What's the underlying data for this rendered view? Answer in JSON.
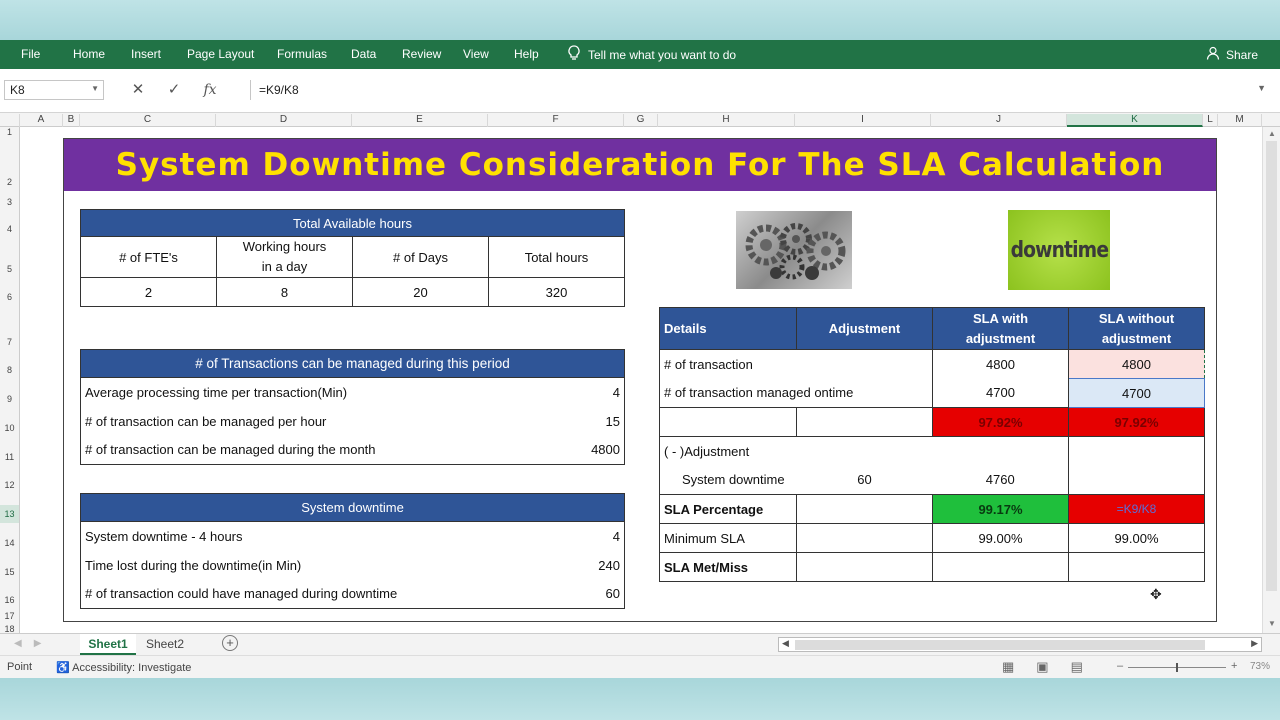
{
  "ribbon": {
    "tabs": [
      "File",
      "Home",
      "Insert",
      "Page Layout",
      "Formulas",
      "Data",
      "Review",
      "View",
      "Help"
    ],
    "tell_me": "Tell me what you want to do",
    "share": "Share"
  },
  "formula_bar": {
    "name_box": "K8",
    "cancel_icon": "✕",
    "enter_icon": "✓",
    "fx_icon": "fx",
    "formula": "=K9/K8"
  },
  "columns": [
    "A",
    "B",
    "C",
    "D",
    "E",
    "F",
    "G",
    "H",
    "I",
    "J",
    "K",
    "L",
    "M"
  ],
  "selected_column": "K",
  "rows": [
    "1",
    "2",
    "3",
    "4",
    "5",
    "6",
    "7",
    "8",
    "9",
    "10",
    "11",
    "12",
    "13",
    "14",
    "15",
    "16",
    "17",
    "18"
  ],
  "selected_row": "13",
  "title": "System Downtime Consideration For The SLA Calculation",
  "available_hours": {
    "header": "Total Available hours",
    "col1": "# of FTE's",
    "col2a": "Working hours",
    "col2b": "in a day",
    "col3": "# of Days",
    "col4": "Total hours",
    "v1": "2",
    "v2": "8",
    "v3": "20",
    "v4": "320"
  },
  "transactions": {
    "header": "# of Transactions can be managed during this period",
    "rows": [
      {
        "label": "Average processing time per transaction(Min)",
        "value": "4"
      },
      {
        "label": "# of transaction can be managed per hour",
        "value": "15"
      },
      {
        "label": "# of transaction can be managed during the month",
        "value": "4800"
      }
    ]
  },
  "downtime": {
    "header": "System downtime",
    "rows": [
      {
        "label": "System downtime - 4 hours",
        "value": "4"
      },
      {
        "label": "Time lost during the downtime(in Min)",
        "value": "240"
      },
      {
        "label": "# of transaction could have managed during downtime",
        "value": "60"
      }
    ]
  },
  "images": {
    "gears": "gears-image",
    "downtime_word": "downtime"
  },
  "sla": {
    "h_details": "Details",
    "h_adjustment": "Adjustment",
    "h_with_a": "SLA with",
    "h_with_b": "adjustment",
    "h_without_a": "SLA without",
    "h_without_b": "adjustment",
    "r8_label": "# of transaction",
    "r8_with": "4800",
    "r8_without": "4800",
    "r9_label": "# of transaction managed ontime",
    "r9_with": "4700",
    "r9_without": "4700",
    "r10_with": "97.92%",
    "r10_without": "97.92%",
    "r11_label": "( - )Adjustment",
    "r12_label": "System downtime",
    "r12_adj": "60",
    "r12_with": "4760",
    "r13_label": "SLA Percentage",
    "r13_with": "99.17%",
    "r13_without": "=K9/K8",
    "r14_label": "Minimum SLA",
    "r14_with": "99.00%",
    "r14_without": "99.00%",
    "r15_label": "SLA Met/Miss"
  },
  "sheet_tabs": [
    "Sheet1",
    "Sheet2"
  ],
  "status": {
    "mode": "Point",
    "accessibility": "Accessibility: Investigate",
    "zoom": "73%"
  },
  "colors": {
    "ribbon": "#217346",
    "title_bg": "#7030a0",
    "title_text": "#ffe100",
    "header_blue": "#2f5597",
    "red": "#e60000",
    "green": "#1fbf3c"
  }
}
